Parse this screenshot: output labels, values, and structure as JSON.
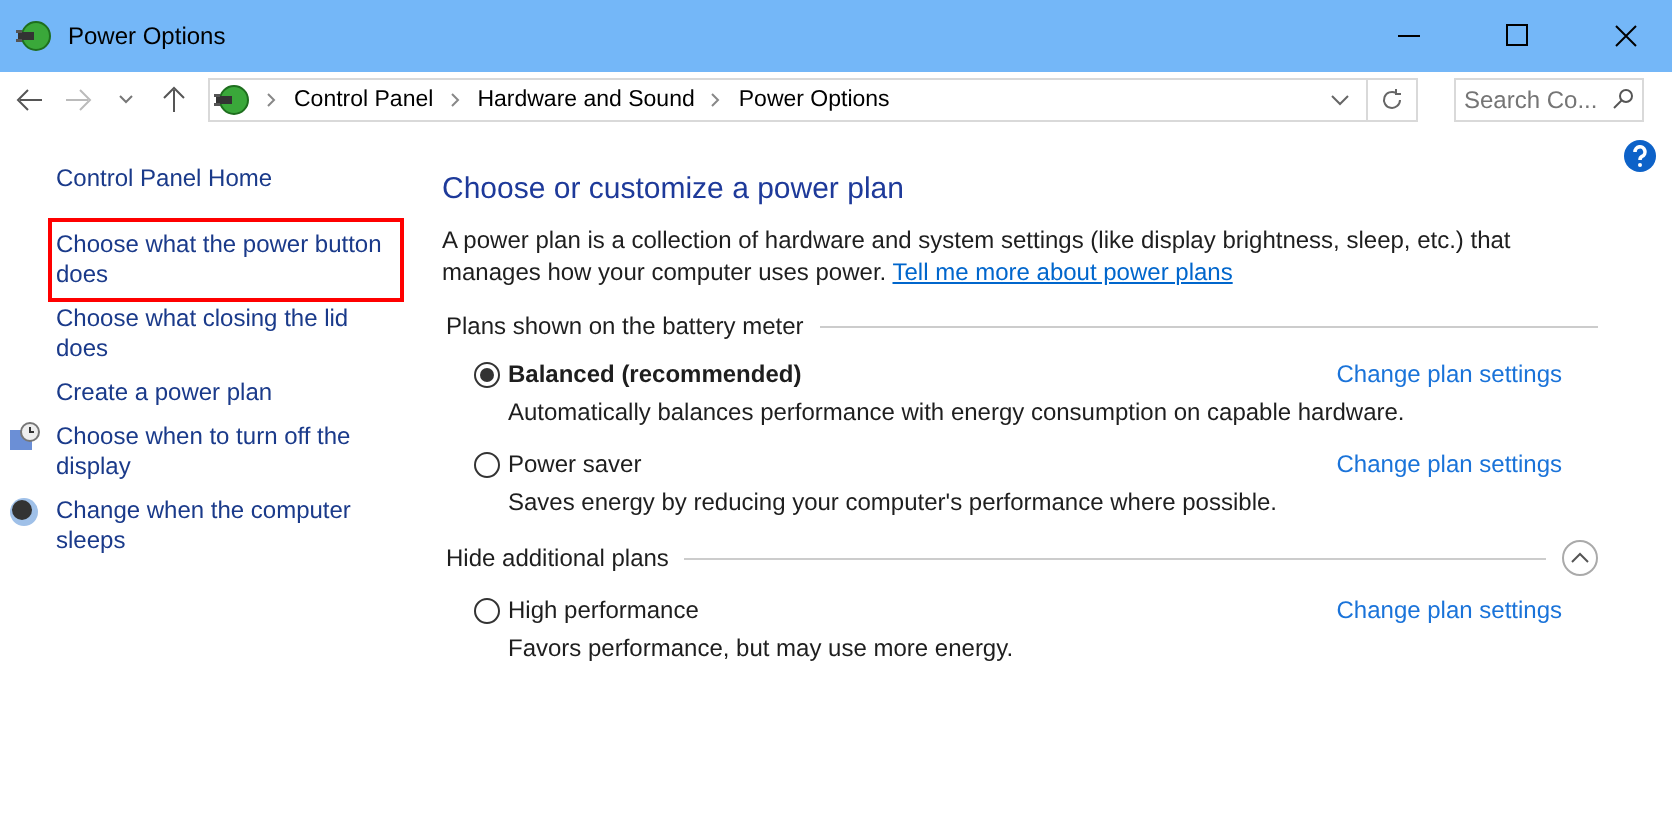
{
  "window": {
    "title": "Power Options"
  },
  "address_bar": {
    "breadcrumbs": [
      "Control Panel",
      "Hardware and Sound",
      "Power Options"
    ]
  },
  "search": {
    "placeholder": "Search Co..."
  },
  "sidebar": {
    "items": [
      {
        "label": "Control Panel Home",
        "highlighted": false
      },
      {
        "label": "Choose what the power button does",
        "highlighted": true
      },
      {
        "label": "Choose what closing the lid does",
        "highlighted": false
      },
      {
        "label": "Create a power plan",
        "highlighted": false
      },
      {
        "label": "Choose when to turn off the display",
        "highlighted": false
      },
      {
        "label": "Change when the computer sleeps",
        "highlighted": false
      }
    ]
  },
  "main": {
    "heading": "Choose or customize a power plan",
    "intro": "A power plan is a collection of hardware and system settings (like display brightness, sleep, etc.) that manages how your computer uses power.",
    "intro_link": "Tell me more about power plans",
    "groups": [
      {
        "title": "Plans shown on the battery meter",
        "kind": "fixed",
        "plans": [
          {
            "name": "Balanced (recommended)",
            "selected": true,
            "link": "Change plan settings",
            "description": "Automatically balances performance with energy consumption on capable hardware."
          },
          {
            "name": "Power saver",
            "selected": false,
            "link": "Change plan settings",
            "description": "Saves energy by reducing your computer's performance where possible."
          }
        ]
      },
      {
        "title": "Hide additional plans",
        "kind": "collapsible",
        "plans": [
          {
            "name": "High performance",
            "selected": false,
            "link": "Change plan settings",
            "description": "Favors performance, but may use more energy."
          }
        ]
      }
    ]
  }
}
